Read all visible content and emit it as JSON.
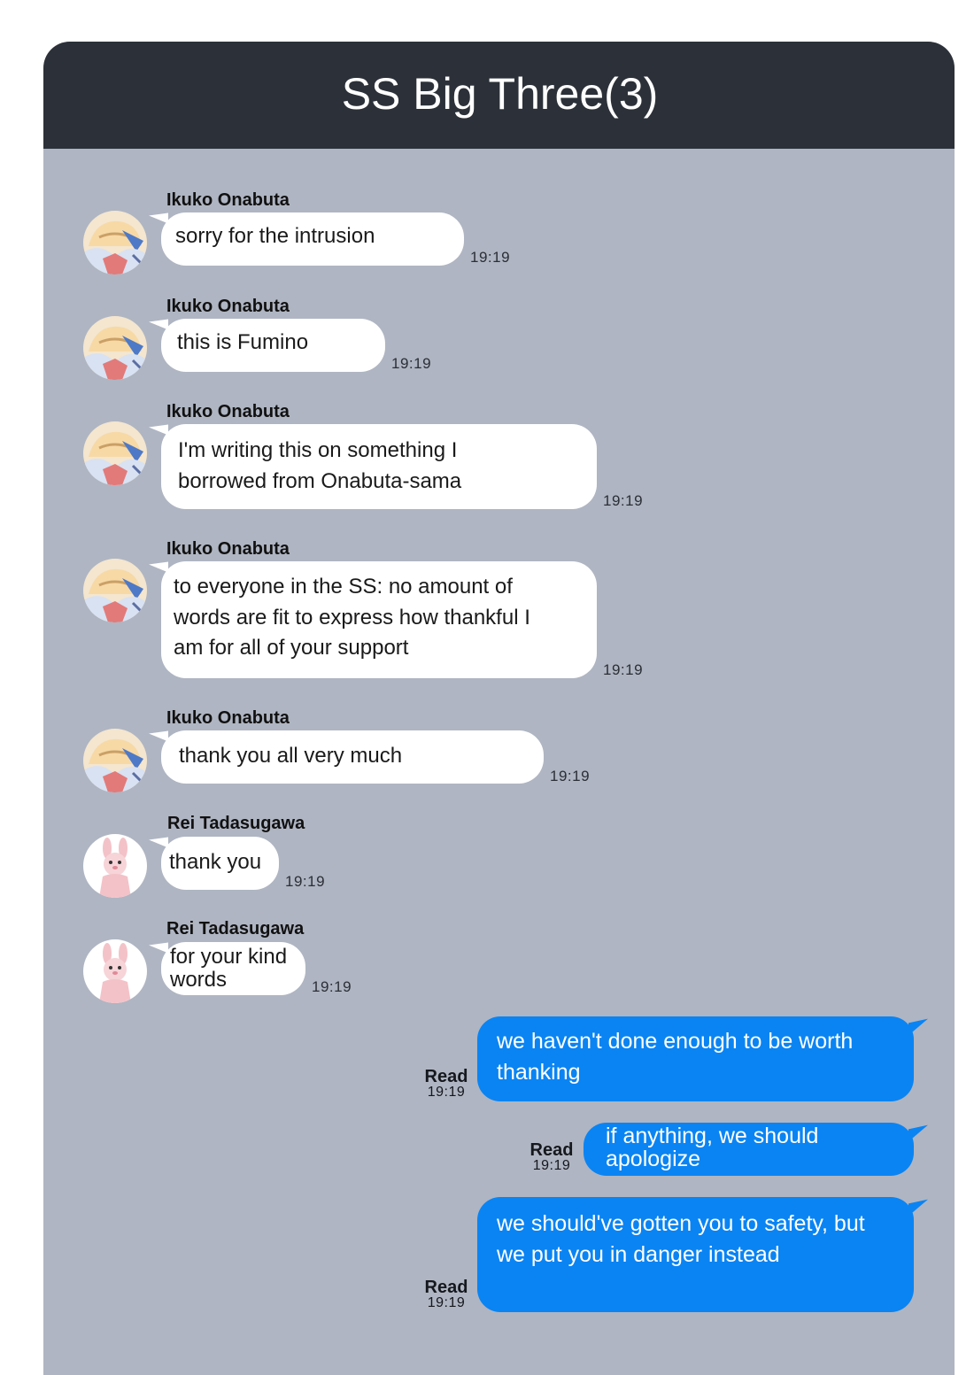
{
  "header": {
    "title": "SS Big Three(3)"
  },
  "incoming": [
    {
      "sender": "Ikuko Onabuta",
      "text": "sorry for the intrusion",
      "time": "19:19",
      "avatar": "hooded-character-avatar"
    },
    {
      "sender": "Ikuko Onabuta",
      "text": "this is Fumino",
      "time": "19:19",
      "avatar": "hooded-character-avatar"
    },
    {
      "sender": "Ikuko Onabuta",
      "text": "I'm writing this on something I\nborrowed from Onabuta-sama",
      "time": "19:19",
      "avatar": "hooded-character-avatar"
    },
    {
      "sender": "Ikuko Onabuta",
      "text": "to everyone in the SS: no amount of\nwords are fit to express how thankful I\nam for all of your support",
      "time": "19:19",
      "avatar": "hooded-character-avatar"
    },
    {
      "sender": "Ikuko Onabuta",
      "text": "thank you all very much",
      "time": "19:19",
      "avatar": "hooded-character-avatar"
    },
    {
      "sender": "Rei Tadasugawa",
      "text": "thank you",
      "time": "19:19",
      "avatar": "pink-bunny-avatar"
    },
    {
      "sender": "Rei Tadasugawa",
      "text": "for your kind\nwords",
      "time": "19:19",
      "avatar": "pink-bunny-avatar"
    }
  ],
  "outgoing": [
    {
      "text": "we haven't done enough to be worth\nthanking",
      "status": "Read",
      "time": "19:19"
    },
    {
      "text": "if anything, we should\napologize",
      "status": "Read",
      "time": "19:19"
    },
    {
      "text": "we should've gotten you to safety, but\nwe put you in danger instead",
      "status": "Read",
      "time": "19:19"
    }
  ],
  "colors": {
    "header": "#2c3139",
    "chat_background": "#afb5c2",
    "incoming_bubble": "#ffffff",
    "outgoing_bubble": "#0a84f3"
  }
}
